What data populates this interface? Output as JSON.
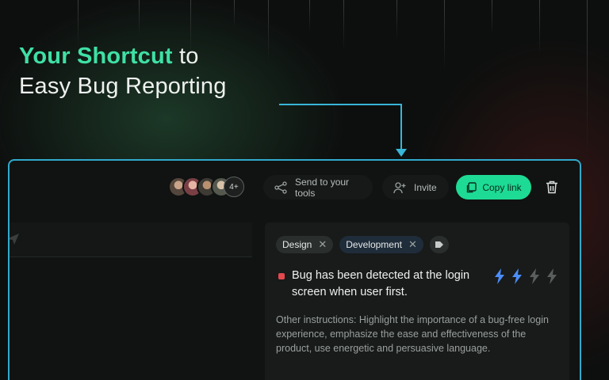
{
  "hero": {
    "accent": "Your Shortcut",
    "line1_rest": " to",
    "line2": "Easy Bug Reporting"
  },
  "toolbar": {
    "avatars_more": "4+",
    "send_label": "Send to your tools",
    "invite_label": "Invite",
    "copy_label": "Copy link"
  },
  "card": {
    "tags": [
      {
        "label": "Design"
      },
      {
        "label": "Development"
      }
    ],
    "bug_title": "Bug has been detected at the login screen when user first.",
    "priority_level": 2,
    "priority_max": 4,
    "description": "Other instructions: Highlight the importance of a bug-free login experience, emphasize the ease and effectiveness of the product, use energetic and persuasive language."
  },
  "colors": {
    "accent_green": "#3fe0a5",
    "button_green": "#1ddb94",
    "frame_blue": "#32a9cc",
    "bolt_active": "#4b8df8",
    "bolt_inactive": "#5a5f5d",
    "bug_red": "#e5484d"
  },
  "icons": {
    "send": "share-nodes-icon",
    "invite": "user-plus-icon",
    "copy": "copy-icon",
    "delete": "trash-icon",
    "priority": "lightning-bolt-icon"
  }
}
